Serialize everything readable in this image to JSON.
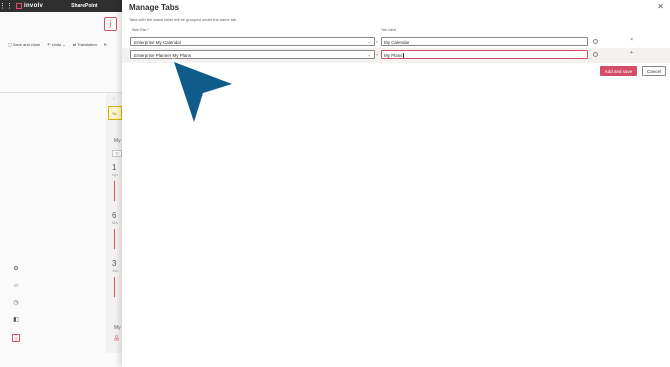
{
  "suite_bar": {
    "brand": "involv",
    "app": "SharePoint"
  },
  "background": {
    "app_icon_glyph": "j",
    "toolbar": {
      "save_close": "Save and close",
      "undo": "Undo",
      "undo_chevron": "⌄",
      "translation": "Translation",
      "overflow": "R"
    },
    "back_glyph": "‹",
    "warning_text": "Yo",
    "section_label_1": "My",
    "filter_glyph": "▽",
    "cards": [
      {
        "num": "1",
        "month": "Apr"
      },
      {
        "num": "6",
        "month": "Ma"
      },
      {
        "num": "3",
        "month": "Jun"
      }
    ],
    "section_label_2": "My",
    "section_glyph_2": "品"
  },
  "panel": {
    "title": "Manage Tabs",
    "close": "✕",
    "subtitle": "Tabs with the same label will be grouped under the same tab.",
    "columns": {
      "web_part": "Web Part",
      "required_mark": "*",
      "tab_label": "Tab Label"
    },
    "rows": [
      {
        "web_part": "Enterprise My Calendar",
        "tab_label": "My Calendar",
        "action": "×"
      },
      {
        "web_part": "Enterprise Planner My Plans",
        "tab_label": "My Plans",
        "action": "+"
      }
    ],
    "add_save": "Add and save",
    "cancel": "Cancel"
  },
  "colors": {
    "accent": "#d24f67",
    "arrow": "#0f5b8a",
    "suitebar": "#2f2f2f"
  },
  "icons": {
    "waffle": "waffle-icon",
    "chevron": "chevron-down-icon",
    "link": "link-icon"
  }
}
